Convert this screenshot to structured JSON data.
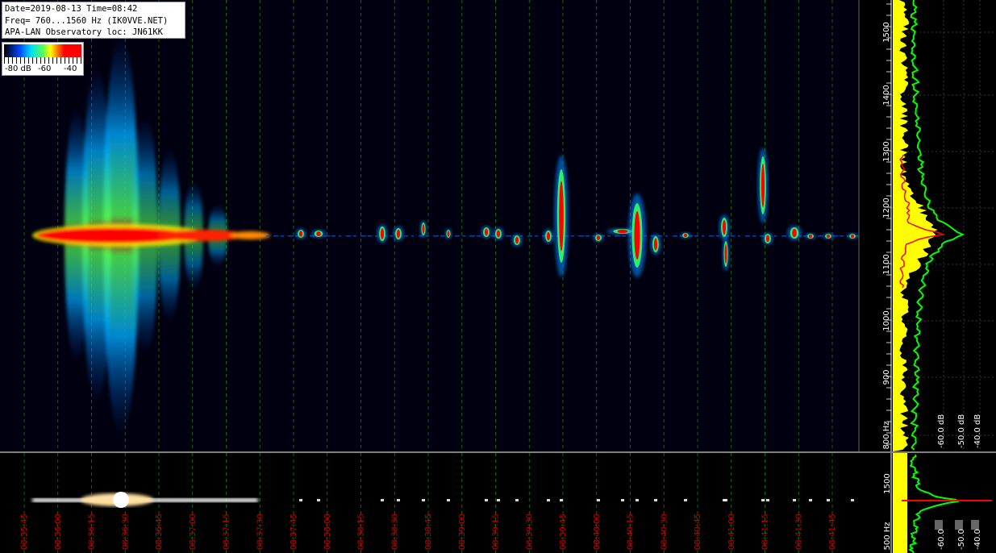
{
  "info": {
    "line1": "Date=2019-08-13 Time=08:42",
    "line2": "Freq= 760...1560 Hz (IK0VVE.NET)",
    "line3": "APA-LAN Observatory loc: JN61KK"
  },
  "legend": {
    "label_min": "-80 dB",
    "label_mid": "-60",
    "label_max": "-40"
  },
  "time_labels": [
    "08:35:45",
    "08:36:00",
    "08:36:15",
    "08:36:30",
    "08:36:45",
    "08:37:00",
    "08:37:15",
    "08:37:30",
    "08:37:45",
    "08:38:00",
    "08:38:15",
    "08:38:30",
    "08:38:45",
    "08:39:00",
    "08:39:15",
    "08:39:30",
    "08:39:45",
    "08:40:00",
    "08:40:15",
    "08:40:30",
    "08:40:45",
    "08:41:00",
    "08:41:15",
    "08:41:30",
    "08:41:45"
  ],
  "freq_labels": [
    "1500",
    "1400",
    "1300",
    "1200",
    "1100",
    "1000",
    "900",
    "800 Hz"
  ],
  "mini_freq_labels": [
    "1500",
    "500 Hz"
  ],
  "db_labels": [
    "-60.0 dB",
    "-50.0 dB",
    "-40.0 dB"
  ],
  "mini_db_labels": [
    "-60.0",
    "-50.0",
    "-40.0"
  ],
  "colors": {
    "spectrum_avg": "#00ff00",
    "spectrum_peak": "#ffff00",
    "spectrum_line": "#ff0000",
    "grid": "#00aa00",
    "time_label": "#cc0000"
  }
}
